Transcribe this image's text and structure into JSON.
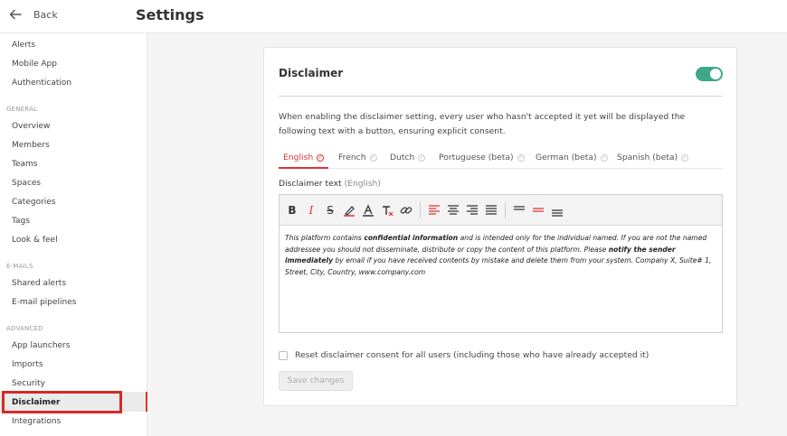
{
  "header": {
    "back_label": "Back",
    "title": "Settings"
  },
  "sidebar": {
    "top_items": [
      "Alerts",
      "Mobile App",
      "Authentication"
    ],
    "sections": [
      {
        "title": "GENERAL",
        "items": [
          "Overview",
          "Members",
          "Teams",
          "Spaces",
          "Categories",
          "Tags",
          "Look & feel"
        ]
      },
      {
        "title": "E-MAILS",
        "items": [
          "Shared alerts",
          "E-mail pipelines"
        ]
      },
      {
        "title": "ADVANCED",
        "items": [
          "App launchers",
          "Imports",
          "Security",
          "Disclaimer",
          "Integrations"
        ]
      }
    ],
    "active_item": "Disclaimer"
  },
  "card": {
    "title": "Disclaimer",
    "toggle_on": true,
    "description": "When enabling the disclaimer setting, every user who hasn't accepted it yet will be displayed the following text with a button, ensuring explicit consent.",
    "tabs": [
      "English",
      "French",
      "Dutch",
      "Portuguese (beta)",
      "German (beta)",
      "Spanish (beta)"
    ],
    "active_tab": "English",
    "field_label": "Disclaimer text",
    "field_lang": "(English)",
    "editor": {
      "toolbar": [
        "bold-icon",
        "italic-icon",
        "strikethrough-icon",
        "highlight-icon",
        "text-color-icon",
        "clear-format-icon",
        "link-icon",
        "align-left-icon",
        "align-center-icon",
        "align-right-icon",
        "align-justify-icon",
        "line-spacing-icon",
        "horizontal-rule-icon",
        "paragraph-icon"
      ],
      "text_parts": [
        "This platform contains ",
        "confidential information",
        " and is intended only for the individual named. If you are not the named addressee you should not disseminate, distribute or copy the content of this platform. Please ",
        "notify the sender immediately",
        " by email if you have received contents by mistake and delete them from your system. Company X, Suite# 1, Street, City, Country, www.company.com"
      ]
    },
    "reset_label": "Reset disclaimer consent for all users (including those who have already accepted it)",
    "save_label": "Save changes"
  },
  "colors": {
    "accent_red": "#d33333",
    "toggle_green": "#3fa88a",
    "highlight_box": "#d32a2a"
  }
}
